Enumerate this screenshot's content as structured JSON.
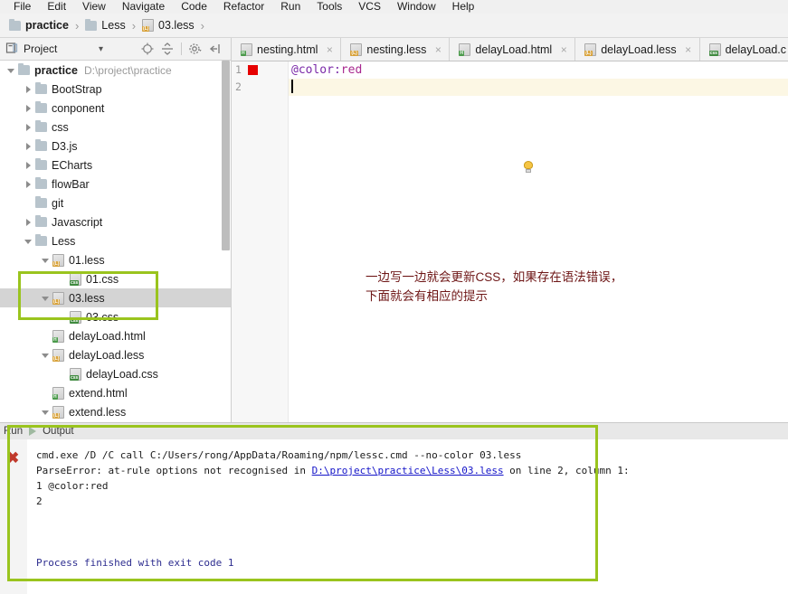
{
  "menu": {
    "items": [
      "File",
      "Edit",
      "View",
      "Navigate",
      "Code",
      "Refactor",
      "Run",
      "Tools",
      "VCS",
      "Window",
      "Help"
    ]
  },
  "breadcrumb": {
    "items": [
      {
        "label": "practice",
        "icon": "folder-icon",
        "bold": true
      },
      {
        "label": "Less",
        "icon": "folder-icon",
        "bold": false
      },
      {
        "label": "03.less",
        "icon": "less-file-icon",
        "bold": false
      }
    ],
    "separator": "›"
  },
  "project_panel": {
    "title": "Project",
    "dropdown": "▾",
    "icons": [
      "locate-target-icon",
      "collapse-all-icon",
      "settings-gear-icon",
      "hide-panel-icon"
    ]
  },
  "tree": {
    "rows": [
      {
        "label": "practice",
        "path": "D:\\project\\practice",
        "icon": "folder-icon",
        "twist": "open",
        "indent": 0,
        "bold": true,
        "selected": false
      },
      {
        "label": "BootStrap",
        "path": "",
        "icon": "folder-icon",
        "twist": "closed",
        "indent": 1,
        "bold": false,
        "selected": false
      },
      {
        "label": "conponent",
        "path": "",
        "icon": "folder-icon",
        "twist": "closed",
        "indent": 1,
        "bold": false,
        "selected": false
      },
      {
        "label": "css",
        "path": "",
        "icon": "folder-icon",
        "twist": "closed",
        "indent": 1,
        "bold": false,
        "selected": false
      },
      {
        "label": "D3.js",
        "path": "",
        "icon": "folder-icon",
        "twist": "closed",
        "indent": 1,
        "bold": false,
        "selected": false
      },
      {
        "label": "ECharts",
        "path": "",
        "icon": "folder-icon",
        "twist": "closed",
        "indent": 1,
        "bold": false,
        "selected": false
      },
      {
        "label": "flowBar",
        "path": "",
        "icon": "folder-icon",
        "twist": "closed",
        "indent": 1,
        "bold": false,
        "selected": false
      },
      {
        "label": "git",
        "path": "",
        "icon": "folder-icon",
        "twist": "none",
        "indent": 1,
        "bold": false,
        "selected": false
      },
      {
        "label": "Javascript",
        "path": "",
        "icon": "folder-icon",
        "twist": "closed",
        "indent": 1,
        "bold": false,
        "selected": false
      },
      {
        "label": "Less",
        "path": "",
        "icon": "folder-icon",
        "twist": "open",
        "indent": 1,
        "bold": false,
        "selected": false
      },
      {
        "label": "01.less",
        "path": "",
        "icon": "less-file-icon",
        "twist": "open",
        "indent": 2,
        "bold": false,
        "selected": false
      },
      {
        "label": "01.css",
        "path": "",
        "icon": "css-file-icon",
        "twist": "none",
        "indent": 3,
        "bold": false,
        "selected": false
      },
      {
        "label": "03.less",
        "path": "",
        "icon": "less-file-icon",
        "twist": "open",
        "indent": 2,
        "bold": false,
        "selected": true
      },
      {
        "label": "03.css",
        "path": "",
        "icon": "css-file-icon",
        "twist": "none",
        "indent": 3,
        "bold": false,
        "selected": false
      },
      {
        "label": "delayLoad.html",
        "path": "",
        "icon": "html-file-icon",
        "twist": "none",
        "indent": 2,
        "bold": false,
        "selected": false
      },
      {
        "label": "delayLoad.less",
        "path": "",
        "icon": "less-file-icon",
        "twist": "open",
        "indent": 2,
        "bold": false,
        "selected": false
      },
      {
        "label": "delayLoad.css",
        "path": "",
        "icon": "css-file-icon",
        "twist": "none",
        "indent": 3,
        "bold": false,
        "selected": false
      },
      {
        "label": "extend.html",
        "path": "",
        "icon": "html-file-icon",
        "twist": "none",
        "indent": 2,
        "bold": false,
        "selected": false
      },
      {
        "label": "extend.less",
        "path": "",
        "icon": "less-file-icon",
        "twist": "open",
        "indent": 2,
        "bold": false,
        "selected": false
      }
    ]
  },
  "tabs": [
    {
      "label": "nesting.html",
      "icon": "html-file-icon",
      "close": "×"
    },
    {
      "label": "nesting.less",
      "icon": "less-file-icon",
      "close": "×"
    },
    {
      "label": "delayLoad.html",
      "icon": "html-file-icon",
      "close": "×"
    },
    {
      "label": "delayLoad.less",
      "icon": "less-file-icon",
      "close": "×"
    },
    {
      "label": "delayLoad.c",
      "icon": "css-file-icon",
      "close": ""
    }
  ],
  "editor": {
    "line_numbers": [
      "1",
      "2"
    ],
    "code": {
      "variable": "@color",
      "colon": ":",
      "value": "red"
    },
    "breakpoint_line": 1,
    "current_line": 2,
    "annotation": "一边写一边就会更新CSS，如果存在语法错误，\n下面就会有相应的提示"
  },
  "run_panel": {
    "tool_label": "Run",
    "tab_label": "Output",
    "console_lines": [
      {
        "text": "cmd.exe /D /C call C:/Users/rong/AppData/Roaming/npm/lessc.cmd --no-color 03.less",
        "style": "normal"
      },
      {
        "text": "ParseError: at-rule options not recognised in ",
        "style": "normal",
        "link": "D:\\project\\practice\\Less\\03.less",
        "tail": " on line 2, column 1:"
      },
      {
        "text": "1 @color:red",
        "style": "normal"
      },
      {
        "text": "2",
        "style": "normal"
      },
      {
        "text": "",
        "style": "normal"
      },
      {
        "text": "",
        "style": "normal"
      },
      {
        "text": "Process finished with exit code 1",
        "style": "blue"
      }
    ]
  },
  "colors": {
    "highlight_green": "#9ac41e",
    "annotation_red": "#6e1616",
    "link_blue": "#1414c8",
    "breakpoint_red": "#e60000",
    "selection_gray": "#d4d4d4"
  }
}
